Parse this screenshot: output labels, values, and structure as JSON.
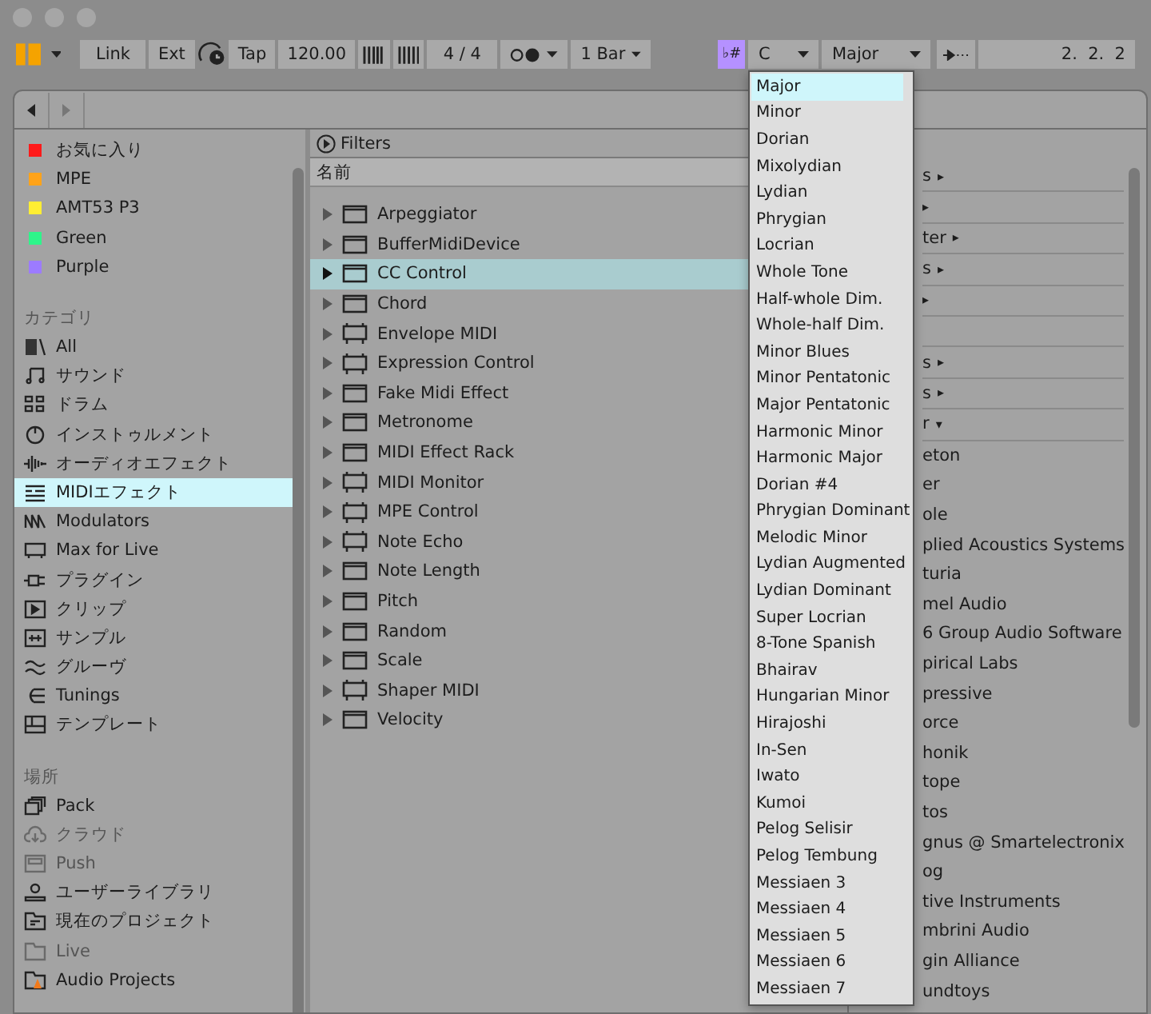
{
  "toolbar": {
    "link": "Link",
    "ext": "Ext",
    "tap": "Tap",
    "tempo": "120.00",
    "signature": "4 / 4",
    "quantize": "1 Bar",
    "scale_button": {
      "label": "♭#",
      "on": true
    },
    "root": "C",
    "scale": "Major",
    "position": "2.  2.  2"
  },
  "sidebar": {
    "collections": [
      {
        "label": "お気に入り",
        "color": "#ff1a1a"
      },
      {
        "label": "MPE",
        "color": "#ffa31a"
      },
      {
        "label": "AMT53 P3",
        "color": "#ffee33"
      },
      {
        "label": "Green",
        "color": "#2ef58a"
      },
      {
        "label": "Purple",
        "color": "#9c7bff"
      }
    ],
    "categories_title": "カテゴリ",
    "categories": [
      {
        "label": "All",
        "selected": false
      },
      {
        "label": "サウンド",
        "selected": false
      },
      {
        "label": "ドラム",
        "selected": false
      },
      {
        "label": "インストゥルメント",
        "selected": false
      },
      {
        "label": "オーディオエフェクト",
        "selected": false
      },
      {
        "label": "MIDIエフェクト",
        "selected": true
      },
      {
        "label": "Modulators",
        "selected": false
      },
      {
        "label": "Max for Live",
        "selected": false
      },
      {
        "label": "プラグイン",
        "selected": false
      },
      {
        "label": "クリップ",
        "selected": false
      },
      {
        "label": "サンプル",
        "selected": false
      },
      {
        "label": "グルーヴ",
        "selected": false
      },
      {
        "label": "Tunings",
        "selected": false
      },
      {
        "label": "テンプレート",
        "selected": false
      }
    ],
    "places_title": "場所",
    "places": [
      {
        "label": "Pack",
        "disabled": false
      },
      {
        "label": "クラウド",
        "disabled": true
      },
      {
        "label": "Push",
        "disabled": true
      },
      {
        "label": "ユーザーライブラリ",
        "disabled": false
      },
      {
        "label": "現在のプロジェクト",
        "disabled": false
      },
      {
        "label": "Live",
        "disabled": true
      },
      {
        "label": "Audio Projects",
        "disabled": false
      }
    ]
  },
  "filters": "Filters",
  "column_header": "名前",
  "devices": [
    {
      "name": "Arpeggiator",
      "kind": "native",
      "selected": false
    },
    {
      "name": "BufferMidiDevice",
      "kind": "native",
      "selected": false
    },
    {
      "name": "CC Control",
      "kind": "native",
      "selected": true
    },
    {
      "name": "Chord",
      "kind": "native",
      "selected": false
    },
    {
      "name": "Envelope MIDI",
      "kind": "m4l",
      "selected": false
    },
    {
      "name": "Expression Control",
      "kind": "m4l",
      "selected": false
    },
    {
      "name": "Fake Midi Effect",
      "kind": "native",
      "selected": false
    },
    {
      "name": "Metronome",
      "kind": "native",
      "selected": false
    },
    {
      "name": "MIDI Effect Rack",
      "kind": "native",
      "selected": false
    },
    {
      "name": "MIDI Monitor",
      "kind": "m4l",
      "selected": false
    },
    {
      "name": "MPE Control",
      "kind": "m4l",
      "selected": false
    },
    {
      "name": "Note Echo",
      "kind": "m4l",
      "selected": false
    },
    {
      "name": "Note Length",
      "kind": "native",
      "selected": false
    },
    {
      "name": "Pitch",
      "kind": "native",
      "selected": false
    },
    {
      "name": "Random",
      "kind": "native",
      "selected": false
    },
    {
      "name": "Scale",
      "kind": "native",
      "selected": false
    },
    {
      "name": "Shaper MIDI",
      "kind": "m4l",
      "selected": false
    },
    {
      "name": "Velocity",
      "kind": "native",
      "selected": false
    }
  ],
  "right_rows": [
    {
      "kind": "folder",
      "label": "s",
      "arrow": "▸"
    },
    {
      "kind": "folder",
      "arrow": "▸"
    },
    {
      "kind": "folder",
      "label": "ter",
      "arrow": "▸"
    },
    {
      "kind": "folder",
      "label": "s",
      "arrow": "▸"
    },
    {
      "kind": "folder",
      "arrow": "▸"
    },
    {
      "kind": "blank"
    },
    {
      "kind": "folder",
      "label": "s",
      "arrow": "▸"
    },
    {
      "kind": "folder",
      "label": "s",
      "arrow": "▸"
    },
    {
      "kind": "folder",
      "label": "r",
      "arrow": "▾"
    },
    {
      "kind": "vendor",
      "label": "eton"
    },
    {
      "kind": "vendor",
      "label": "er"
    },
    {
      "kind": "vendor",
      "label": "ole"
    },
    {
      "kind": "vendor",
      "label": "plied Acoustics Systems"
    },
    {
      "kind": "vendor",
      "label": "turia"
    },
    {
      "kind": "vendor",
      "label": "mel Audio"
    },
    {
      "kind": "vendor",
      "label": "6 Group Audio Software"
    },
    {
      "kind": "vendor",
      "label": "pirical Labs"
    },
    {
      "kind": "vendor",
      "label": "pressive"
    },
    {
      "kind": "vendor",
      "label": "orce"
    },
    {
      "kind": "vendor",
      "label": "honik"
    },
    {
      "kind": "vendor",
      "label": "tope"
    },
    {
      "kind": "vendor",
      "label": "tos"
    },
    {
      "kind": "vendor",
      "label": "gnus @ Smartelectronix"
    },
    {
      "kind": "vendor",
      "label": "og"
    },
    {
      "kind": "vendor",
      "label": "tive Instruments"
    },
    {
      "kind": "vendor",
      "label": "mbrini Audio"
    },
    {
      "kind": "vendor",
      "label": "gin Alliance"
    },
    {
      "kind": "vendor",
      "label": "undtoys"
    }
  ],
  "scale_menu": [
    {
      "label": "Major",
      "selected": true
    },
    {
      "label": "Minor",
      "selected": false
    },
    {
      "label": "Dorian",
      "selected": false
    },
    {
      "label": "Mixolydian",
      "selected": false
    },
    {
      "label": "Lydian",
      "selected": false
    },
    {
      "label": "Phrygian",
      "selected": false
    },
    {
      "label": "Locrian",
      "selected": false
    },
    {
      "label": "Whole Tone",
      "selected": false
    },
    {
      "label": "Half-whole Dim.",
      "selected": false
    },
    {
      "label": "Whole-half Dim.",
      "selected": false
    },
    {
      "label": "Minor Blues",
      "selected": false
    },
    {
      "label": "Minor Pentatonic",
      "selected": false
    },
    {
      "label": "Major Pentatonic",
      "selected": false
    },
    {
      "label": "Harmonic Minor",
      "selected": false
    },
    {
      "label": "Harmonic Major",
      "selected": false
    },
    {
      "label": "Dorian #4",
      "selected": false
    },
    {
      "label": "Phrygian Dominant",
      "selected": false
    },
    {
      "label": "Melodic Minor",
      "selected": false
    },
    {
      "label": "Lydian Augmented",
      "selected": false
    },
    {
      "label": "Lydian Dominant",
      "selected": false
    },
    {
      "label": "Super Locrian",
      "selected": false
    },
    {
      "label": "8-Tone Spanish",
      "selected": false
    },
    {
      "label": "Bhairav",
      "selected": false
    },
    {
      "label": "Hungarian Minor",
      "selected": false
    },
    {
      "label": "Hirajoshi",
      "selected": false
    },
    {
      "label": "In-Sen",
      "selected": false
    },
    {
      "label": "Iwato",
      "selected": false
    },
    {
      "label": "Kumoi",
      "selected": false
    },
    {
      "label": "Pelog Selisir",
      "selected": false
    },
    {
      "label": "Pelog Tembung",
      "selected": false
    },
    {
      "label": "Messiaen 3",
      "selected": false
    },
    {
      "label": "Messiaen 4",
      "selected": false
    },
    {
      "label": "Messiaen 5",
      "selected": false
    },
    {
      "label": "Messiaen 6",
      "selected": false
    },
    {
      "label": "Messiaen 7",
      "selected": false
    }
  ]
}
